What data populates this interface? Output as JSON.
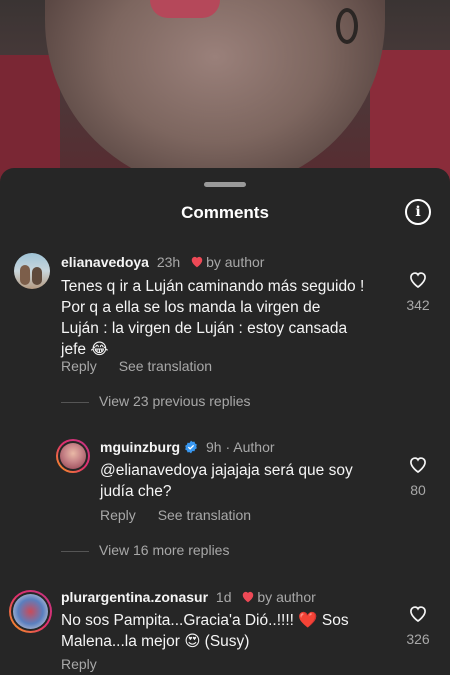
{
  "sheet": {
    "title": "Comments"
  },
  "comments": [
    {
      "username": "elianavedoya",
      "time": "23h",
      "by_author": "by author",
      "text_lines": [
        "Tenes q ir a Luján caminando más seguido !",
        "Por q a ella se los manda la virgen de",
        "Luján : la virgen de Luján : estoy cansada",
        "jefe 😂"
      ],
      "likes": "342",
      "reply_label": "Reply",
      "translate_label": "See translation",
      "replies_link": "View 23 previous replies"
    },
    {
      "username": "mguinzburg",
      "time": "9h",
      "separator": "·",
      "author_badge": "Author",
      "text_lines": [
        "@elianavedoya jajajaja será que soy",
        "judía che?"
      ],
      "likes": "80",
      "reply_label": "Reply",
      "translate_label": "See translation",
      "replies_link": "View 16 more replies"
    },
    {
      "username": "plurargentina.zonasur",
      "time": "1d",
      "by_author": "by author",
      "text_lines": [
        "No sos Pampita...Gracia'a Dió..!!!! ❤️ Sos",
        "Malena...la mejor 😍 (Susy)"
      ],
      "likes": "326",
      "reply_label": "Reply"
    }
  ],
  "colors": {
    "sheet_bg": "#262626",
    "secondary_text": "#a8a8a8",
    "heart_red": "#ed4956",
    "verified_blue": "#3897f0"
  }
}
